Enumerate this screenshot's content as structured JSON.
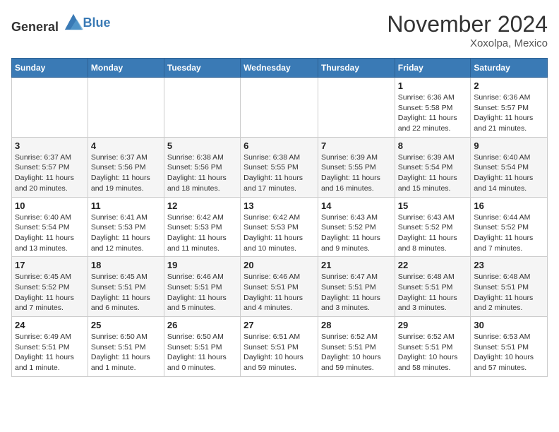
{
  "logo": {
    "general": "General",
    "blue": "Blue"
  },
  "title": "November 2024",
  "location": "Xoxolpa, Mexico",
  "days_header": [
    "Sunday",
    "Monday",
    "Tuesday",
    "Wednesday",
    "Thursday",
    "Friday",
    "Saturday"
  ],
  "weeks": [
    [
      {
        "day": "",
        "info": ""
      },
      {
        "day": "",
        "info": ""
      },
      {
        "day": "",
        "info": ""
      },
      {
        "day": "",
        "info": ""
      },
      {
        "day": "",
        "info": ""
      },
      {
        "day": "1",
        "info": "Sunrise: 6:36 AM\nSunset: 5:58 PM\nDaylight: 11 hours and 22 minutes."
      },
      {
        "day": "2",
        "info": "Sunrise: 6:36 AM\nSunset: 5:57 PM\nDaylight: 11 hours and 21 minutes."
      }
    ],
    [
      {
        "day": "3",
        "info": "Sunrise: 6:37 AM\nSunset: 5:57 PM\nDaylight: 11 hours and 20 minutes."
      },
      {
        "day": "4",
        "info": "Sunrise: 6:37 AM\nSunset: 5:56 PM\nDaylight: 11 hours and 19 minutes."
      },
      {
        "day": "5",
        "info": "Sunrise: 6:38 AM\nSunset: 5:56 PM\nDaylight: 11 hours and 18 minutes."
      },
      {
        "day": "6",
        "info": "Sunrise: 6:38 AM\nSunset: 5:55 PM\nDaylight: 11 hours and 17 minutes."
      },
      {
        "day": "7",
        "info": "Sunrise: 6:39 AM\nSunset: 5:55 PM\nDaylight: 11 hours and 16 minutes."
      },
      {
        "day": "8",
        "info": "Sunrise: 6:39 AM\nSunset: 5:54 PM\nDaylight: 11 hours and 15 minutes."
      },
      {
        "day": "9",
        "info": "Sunrise: 6:40 AM\nSunset: 5:54 PM\nDaylight: 11 hours and 14 minutes."
      }
    ],
    [
      {
        "day": "10",
        "info": "Sunrise: 6:40 AM\nSunset: 5:54 PM\nDaylight: 11 hours and 13 minutes."
      },
      {
        "day": "11",
        "info": "Sunrise: 6:41 AM\nSunset: 5:53 PM\nDaylight: 11 hours and 12 minutes."
      },
      {
        "day": "12",
        "info": "Sunrise: 6:42 AM\nSunset: 5:53 PM\nDaylight: 11 hours and 11 minutes."
      },
      {
        "day": "13",
        "info": "Sunrise: 6:42 AM\nSunset: 5:53 PM\nDaylight: 11 hours and 10 minutes."
      },
      {
        "day": "14",
        "info": "Sunrise: 6:43 AM\nSunset: 5:52 PM\nDaylight: 11 hours and 9 minutes."
      },
      {
        "day": "15",
        "info": "Sunrise: 6:43 AM\nSunset: 5:52 PM\nDaylight: 11 hours and 8 minutes."
      },
      {
        "day": "16",
        "info": "Sunrise: 6:44 AM\nSunset: 5:52 PM\nDaylight: 11 hours and 7 minutes."
      }
    ],
    [
      {
        "day": "17",
        "info": "Sunrise: 6:45 AM\nSunset: 5:52 PM\nDaylight: 11 hours and 7 minutes."
      },
      {
        "day": "18",
        "info": "Sunrise: 6:45 AM\nSunset: 5:51 PM\nDaylight: 11 hours and 6 minutes."
      },
      {
        "day": "19",
        "info": "Sunrise: 6:46 AM\nSunset: 5:51 PM\nDaylight: 11 hours and 5 minutes."
      },
      {
        "day": "20",
        "info": "Sunrise: 6:46 AM\nSunset: 5:51 PM\nDaylight: 11 hours and 4 minutes."
      },
      {
        "day": "21",
        "info": "Sunrise: 6:47 AM\nSunset: 5:51 PM\nDaylight: 11 hours and 3 minutes."
      },
      {
        "day": "22",
        "info": "Sunrise: 6:48 AM\nSunset: 5:51 PM\nDaylight: 11 hours and 3 minutes."
      },
      {
        "day": "23",
        "info": "Sunrise: 6:48 AM\nSunset: 5:51 PM\nDaylight: 11 hours and 2 minutes."
      }
    ],
    [
      {
        "day": "24",
        "info": "Sunrise: 6:49 AM\nSunset: 5:51 PM\nDaylight: 11 hours and 1 minute."
      },
      {
        "day": "25",
        "info": "Sunrise: 6:50 AM\nSunset: 5:51 PM\nDaylight: 11 hours and 1 minute."
      },
      {
        "day": "26",
        "info": "Sunrise: 6:50 AM\nSunset: 5:51 PM\nDaylight: 11 hours and 0 minutes."
      },
      {
        "day": "27",
        "info": "Sunrise: 6:51 AM\nSunset: 5:51 PM\nDaylight: 10 hours and 59 minutes."
      },
      {
        "day": "28",
        "info": "Sunrise: 6:52 AM\nSunset: 5:51 PM\nDaylight: 10 hours and 59 minutes."
      },
      {
        "day": "29",
        "info": "Sunrise: 6:52 AM\nSunset: 5:51 PM\nDaylight: 10 hours and 58 minutes."
      },
      {
        "day": "30",
        "info": "Sunrise: 6:53 AM\nSunset: 5:51 PM\nDaylight: 10 hours and 57 minutes."
      }
    ]
  ]
}
